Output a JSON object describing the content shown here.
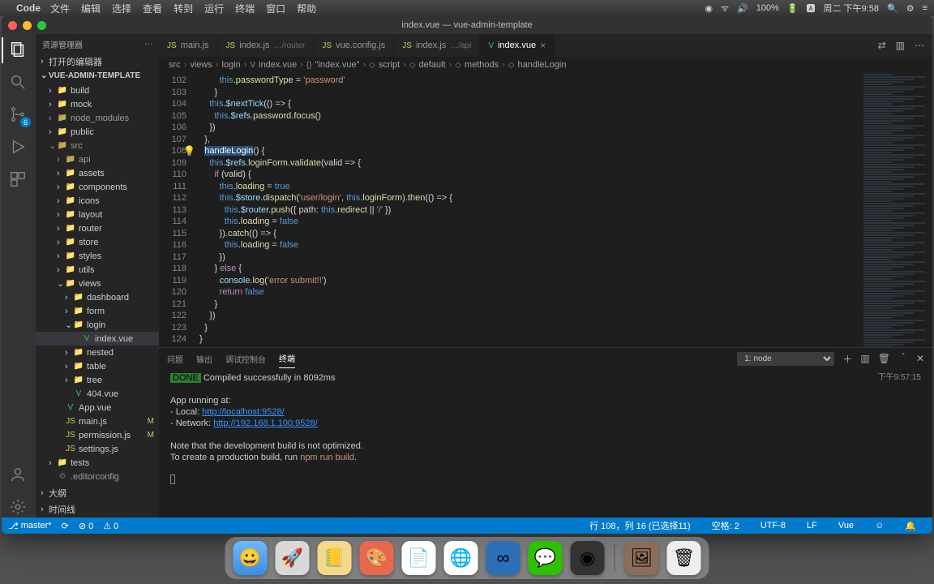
{
  "menubar": {
    "app": "Code",
    "items": [
      "文件",
      "编辑",
      "选择",
      "查看",
      "转到",
      "运行",
      "终端",
      "窗口",
      "帮助"
    ],
    "right": {
      "battery": "100%",
      "date": "周二 下午9:58"
    }
  },
  "window": {
    "title": "index.vue — vue-admin-template"
  },
  "sidebar": {
    "title": "资源管理器",
    "openEditors": "打开的编辑器",
    "project": "VUE-ADMIN-TEMPLATE",
    "outline": "大纲",
    "timeline": "时间线",
    "tree": [
      {
        "l": "build",
        "d": 1,
        "t": "folder",
        "c": ">"
      },
      {
        "l": "mock",
        "d": 1,
        "t": "folder",
        "c": ">"
      },
      {
        "l": "node_modules",
        "d": 1,
        "t": "folder",
        "c": ">",
        "dim": true
      },
      {
        "l": "public",
        "d": 1,
        "t": "folder",
        "c": ">"
      },
      {
        "l": "src",
        "d": 1,
        "t": "folder",
        "c": "v",
        "dim": true
      },
      {
        "l": "api",
        "d": 2,
        "t": "folder",
        "c": ">",
        "dim": true
      },
      {
        "l": "assets",
        "d": 2,
        "t": "folder",
        "c": ">"
      },
      {
        "l": "components",
        "d": 2,
        "t": "folder",
        "c": ">"
      },
      {
        "l": "icons",
        "d": 2,
        "t": "folder",
        "c": ">"
      },
      {
        "l": "layout",
        "d": 2,
        "t": "folder",
        "c": ">"
      },
      {
        "l": "router",
        "d": 2,
        "t": "folder",
        "c": ">"
      },
      {
        "l": "store",
        "d": 2,
        "t": "folder",
        "c": ">"
      },
      {
        "l": "styles",
        "d": 2,
        "t": "folder",
        "c": ">"
      },
      {
        "l": "utils",
        "d": 2,
        "t": "folder",
        "c": ">"
      },
      {
        "l": "views",
        "d": 2,
        "t": "folder",
        "c": "v"
      },
      {
        "l": "dashboard",
        "d": 3,
        "t": "folder",
        "c": ">"
      },
      {
        "l": "form",
        "d": 3,
        "t": "folder",
        "c": ">"
      },
      {
        "l": "login",
        "d": 3,
        "t": "folder",
        "c": "v"
      },
      {
        "l": "index.vue",
        "d": 4,
        "t": "vue",
        "sel": true
      },
      {
        "l": "nested",
        "d": 3,
        "t": "folder",
        "c": ">"
      },
      {
        "l": "table",
        "d": 3,
        "t": "folder",
        "c": ">"
      },
      {
        "l": "tree",
        "d": 3,
        "t": "folder",
        "c": ">"
      },
      {
        "l": "404.vue",
        "d": 3,
        "t": "vue"
      },
      {
        "l": "App.vue",
        "d": 2,
        "t": "vue"
      },
      {
        "l": "main.js",
        "d": 2,
        "t": "js",
        "mod": "M"
      },
      {
        "l": "permission.js",
        "d": 2,
        "t": "js",
        "mod": "M"
      },
      {
        "l": "settings.js",
        "d": 2,
        "t": "js"
      },
      {
        "l": "tests",
        "d": 1,
        "t": "folder",
        "c": ">"
      },
      {
        "l": ".editorconfig",
        "d": 1,
        "t": "cfg",
        "dim": true
      }
    ]
  },
  "tabs": [
    {
      "icon": "js",
      "label": "main.js"
    },
    {
      "icon": "js",
      "label": "index.js",
      "hint": "…/router"
    },
    {
      "icon": "js",
      "label": "vue.config.js"
    },
    {
      "icon": "js",
      "label": "index.js",
      "hint": "…/api"
    },
    {
      "icon": "vue",
      "label": "index.vue",
      "active": true,
      "close": true
    }
  ],
  "breadcrumbs": [
    "src",
    "views",
    "login",
    "index.vue",
    "\"index.vue\"",
    "script",
    "default",
    "methods",
    "handleLogin"
  ],
  "code": {
    "startLine": 102,
    "lines": [
      "          this.passwordType = 'password'",
      "        }",
      "      this.$nextTick(() => {",
      "        this.$refs.password.focus()",
      "      })",
      "    },",
      "    handleLogin() {",
      "      this.$refs.loginForm.validate(valid => {",
      "        if (valid) {",
      "          this.loading = true",
      "          this.$store.dispatch('user/login', this.loginForm).then(() => {",
      "            this.$router.push({ path: this.redirect || '/' })",
      "            this.loading = false",
      "          }).catch(() => {",
      "            this.loading = false",
      "          })",
      "        } else {",
      "          console.log('error submit!!')",
      "          return false",
      "        }",
      "      })",
      "    }",
      "  }",
      "}"
    ]
  },
  "panel": {
    "tabs": [
      "问题",
      "输出",
      "调试控制台",
      "终端"
    ],
    "activeTab": 3,
    "selector": "1: node",
    "time": "下午9:57:15",
    "terminal": {
      "done": "DONE",
      "compiled": "Compiled successfully in 8092ms",
      "running": "App running at:",
      "localLabel": "- Local:   ",
      "localUrl": "http://localhost:9528/",
      "netLabel": "- Network: ",
      "netUrl": "http://192.168.1.100:9528/",
      "note1": "Note that the development build is not optimized.",
      "note2": "To create a production build, run ",
      "cmd": "npm run build",
      "dot": "."
    }
  },
  "status": {
    "branch": "master*",
    "sync": "⟳",
    "errors": "⊘ 0",
    "warnings": "⚠ 0",
    "pos": "行 108，列 16 (已选择11)",
    "spaces": "空格: 2",
    "encoding": "UTF-8",
    "eol": "LF",
    "lang": "Vue"
  },
  "activity": {
    "badge": "6"
  },
  "dock": [
    "finder",
    "launch",
    "notes",
    "paint",
    "stick",
    "chrome",
    "vscode",
    "wechat",
    "obs",
    "photo",
    "trash"
  ]
}
